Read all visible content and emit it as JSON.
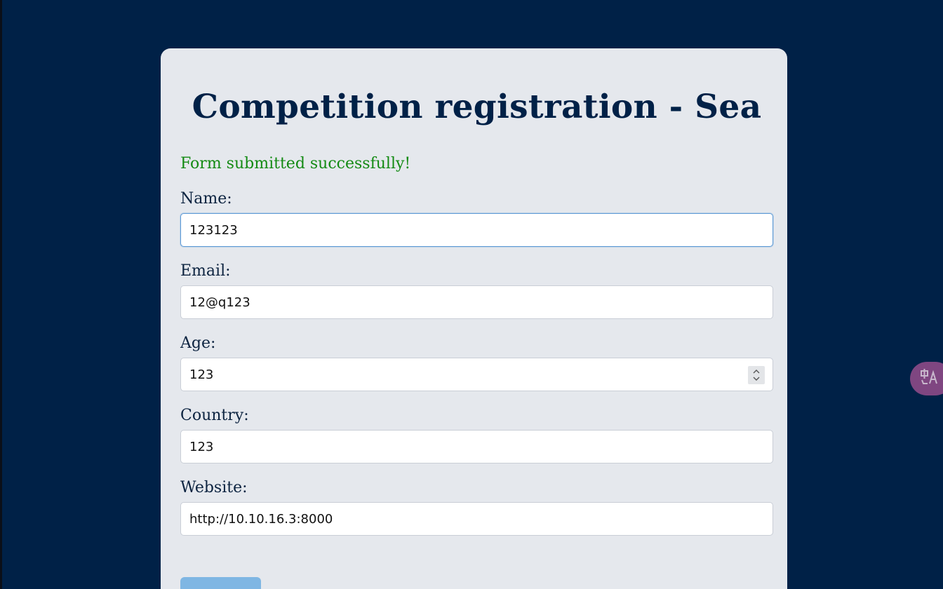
{
  "form": {
    "title": "Competition registration - Sea",
    "success_message": "Form submitted successfully!",
    "fields": [
      {
        "label": "Name:",
        "value": "123123"
      },
      {
        "label": "Email:",
        "value": "12@q123"
      },
      {
        "label": "Age:",
        "value": "123"
      },
      {
        "label": "Country:",
        "value": "123"
      },
      {
        "label": "Website:",
        "value": "http://10.10.16.3:8000"
      }
    ],
    "submit_label": ""
  },
  "colors": {
    "background": "#002147",
    "card": "#e5e8ed",
    "title": "#002147",
    "success": "#138a13",
    "submit_button": "#7fb6e3",
    "translate_button": "#8a4a86"
  },
  "icons": {
    "age_spinner": "stepper-arrows-icon",
    "translate": "translate-icon"
  }
}
